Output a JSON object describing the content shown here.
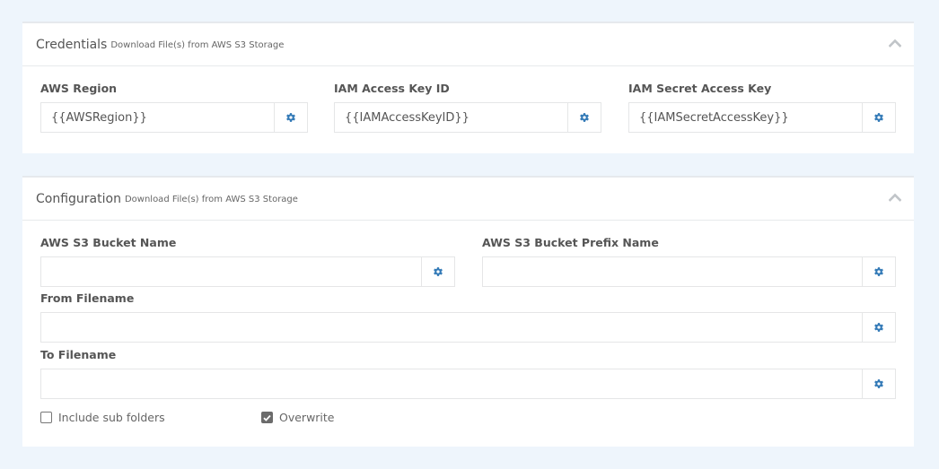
{
  "colors": {
    "page_background": "#eef5fc",
    "panel_background": "#ffffff",
    "gear_icon": "#337ab7",
    "chevron_icon": "#c0c4c8"
  },
  "credentials": {
    "title": "Credentials",
    "subtitle": "Download File(s) from AWS S3 Storage",
    "collapse_icon": "chevron-up-icon",
    "fields": [
      {
        "label": "AWS Region",
        "value": "{{AWSRegion}}",
        "placeholder": "",
        "addon_icon": "gear-icon"
      },
      {
        "label": "IAM Access Key ID",
        "value": "{{IAMAccessKeyID}}",
        "placeholder": "",
        "addon_icon": "gear-icon"
      },
      {
        "label": "IAM Secret Access Key",
        "value": "{{IAMSecretAccessKey}}",
        "placeholder": "",
        "addon_icon": "gear-icon"
      }
    ]
  },
  "configuration": {
    "title": "Configuration",
    "subtitle": "Download File(s) from AWS S3 Storage",
    "collapse_icon": "chevron-up-icon",
    "fields": [
      {
        "label": "AWS S3 Bucket Name",
        "value": "",
        "placeholder": "",
        "addon_icon": "gear-icon"
      },
      {
        "label": "AWS S3 Bucket Prefix Name",
        "value": "",
        "placeholder": "",
        "addon_icon": "gear-icon"
      },
      {
        "label": "From Filename",
        "value": "",
        "placeholder": "",
        "addon_icon": "gear-icon"
      },
      {
        "label": "To Filename",
        "value": "",
        "placeholder": "",
        "addon_icon": "gear-icon"
      }
    ],
    "checkboxes": [
      {
        "label": "Include sub folders",
        "checked": false
      },
      {
        "label": "Overwrite",
        "checked": true
      }
    ]
  }
}
